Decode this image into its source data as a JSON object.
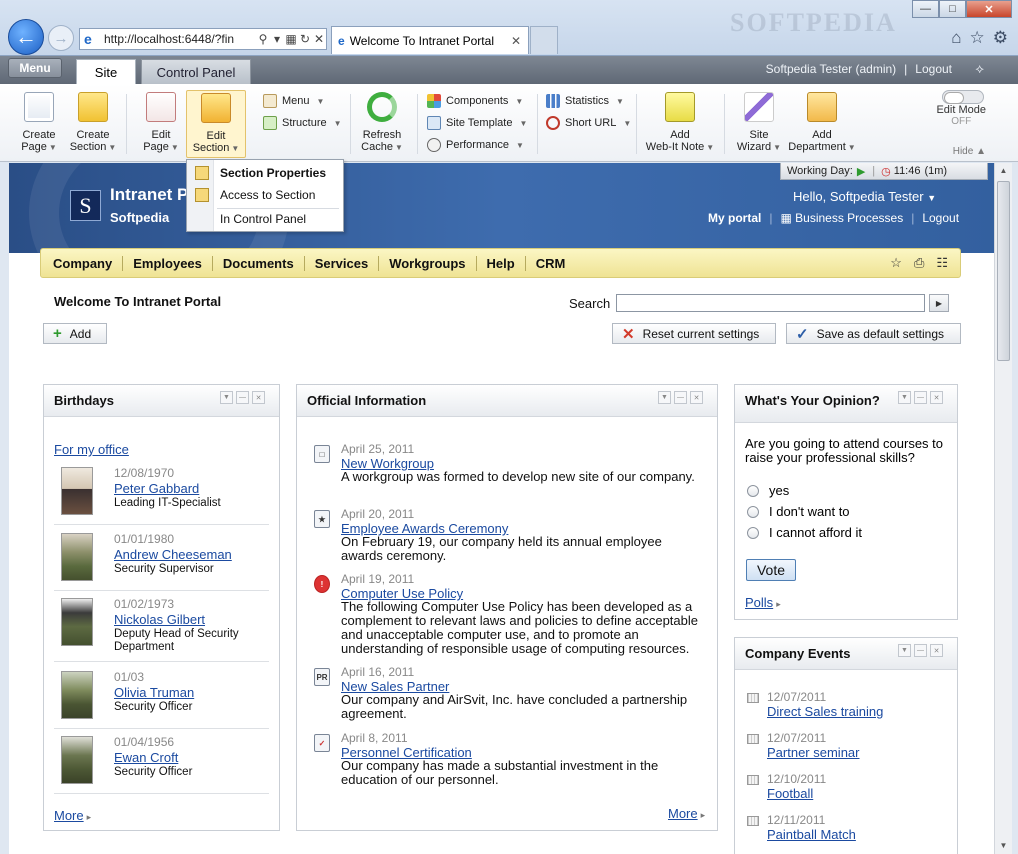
{
  "browser": {
    "address": "http://localhost:6448/?fin",
    "tab_title": "Welcome To Intranet Portal",
    "watermark": "SOFTPEDIA"
  },
  "adminbar": {
    "menu": "Menu",
    "tabs": [
      "Site",
      "Control Panel"
    ],
    "user": "Softpedia Tester (admin)",
    "logout": "Logout"
  },
  "ribbon": {
    "create_page": [
      "Create",
      "Page"
    ],
    "create_section": [
      "Create",
      "Section"
    ],
    "edit_page": [
      "Edit",
      "Page"
    ],
    "edit_section": [
      "Edit",
      "Section"
    ],
    "menu": "Menu",
    "structure": "Structure",
    "refresh_cache": [
      "Refresh",
      "Cache"
    ],
    "components": "Components",
    "site_template": "Site Template",
    "performance": "Performance",
    "statistics": "Statistics",
    "short_url": "Short URL",
    "add_note": [
      "Add",
      "Web-It Note"
    ],
    "site_wizard": [
      "Site",
      "Wizard"
    ],
    "add_department": [
      "Add",
      "Department"
    ],
    "edit_mode": "Edit Mode",
    "edit_mode_state": "OFF",
    "hide": "Hide"
  },
  "dropdown": {
    "items": [
      "Section Properties",
      "Access to Section",
      "In Control Panel"
    ]
  },
  "header": {
    "title": "Intranet P",
    "subtitle": "Softpedia",
    "working_day": "Working Day:",
    "time": "11:46",
    "elapsed": "(1m)",
    "hello": "Hello, Softpedia Tester",
    "my_portal": "My portal",
    "business_processes": "Business Processes",
    "logout": "Logout"
  },
  "nav": [
    "Company",
    "Employees",
    "Documents",
    "Services",
    "Workgroups",
    "Help",
    "CRM"
  ],
  "main": {
    "page_title": "Welcome To Intranet Portal",
    "search_label": "Search",
    "add_label": "Add",
    "reset_label": "Reset current settings",
    "save_default_label": "Save as default settings"
  },
  "birthdays": {
    "title": "Birthdays",
    "filter": "For my office",
    "people": [
      {
        "date": "12/08/1970",
        "name": "Peter Gabbard",
        "position": "Leading IT-Specialist"
      },
      {
        "date": "01/01/1980",
        "name": "Andrew Cheeseman",
        "position": "Security Supervisor"
      },
      {
        "date": "01/02/1973",
        "name": "Nickolas Gilbert",
        "position": "Deputy Head of Security Department"
      },
      {
        "date": "01/03",
        "name": "Olivia Truman",
        "position": "Security Officer"
      },
      {
        "date": "01/04/1956",
        "name": "Ewan Croft",
        "position": "Security Officer"
      }
    ],
    "more": "More"
  },
  "official": {
    "title": "Official Information",
    "items": [
      {
        "date": "April 25, 2011",
        "title": "New Workgroup",
        "text": "A workgroup was formed to develop new site of our company."
      },
      {
        "date": "April 20, 2011",
        "title": "Employee Awards Ceremony",
        "text": "On February 19, our company held its annual employee awards ceremony."
      },
      {
        "date": "April 19, 2011",
        "title": "Computer Use Policy",
        "text": "The following Computer Use Policy has been developed as a complement to relevant laws and policies to define acceptable and unacceptable computer use, and to promote an understanding of responsible usage of computing resources."
      },
      {
        "date": "April 16, 2011",
        "title": "New Sales Partner",
        "text": "Our company and AirSvit, Inc. have concluded a partnership agreement."
      },
      {
        "date": "April 8, 2011",
        "title": "Personnel Certification",
        "text": "Our company has made a substantial investment in the education of our personnel."
      }
    ],
    "more": "More"
  },
  "poll": {
    "title": "What's Your Opinion?",
    "question": "Are you going to attend courses to raise your professional skills?",
    "options": [
      "yes",
      "I don't want to",
      "I cannot afford it"
    ],
    "vote": "Vote",
    "polls_link": "Polls"
  },
  "events": {
    "title": "Company Events",
    "items": [
      {
        "date": "12/07/2011",
        "title": "Direct Sales training"
      },
      {
        "date": "12/07/2011",
        "title": "Partner seminar"
      },
      {
        "date": "12/10/2011",
        "title": "Football"
      },
      {
        "date": "12/11/2011",
        "title": "Paintball Match"
      }
    ]
  }
}
